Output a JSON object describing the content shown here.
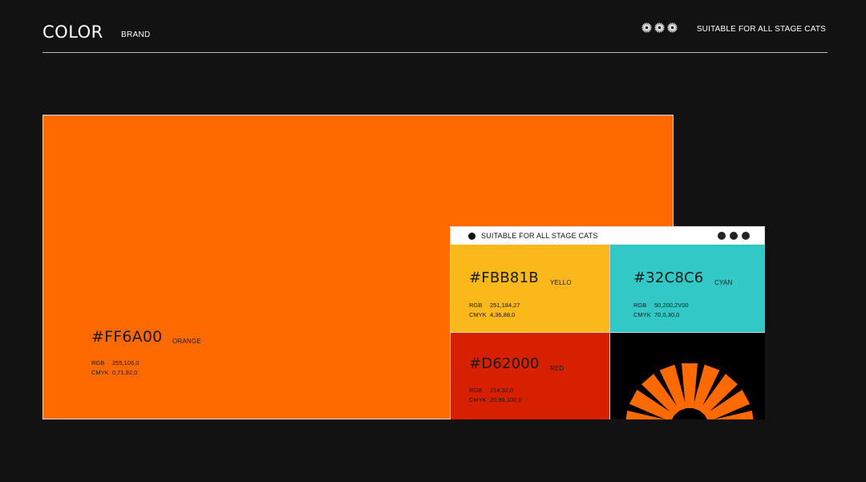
{
  "header": {
    "title": "COLOR",
    "subtitle": "BRAND",
    "tagline": "SUITABLE FOR ALL STAGE CATS",
    "icons": [
      "sunburst-icon",
      "sunburst-icon",
      "sunburst-icon"
    ]
  },
  "main_swatch": {
    "hex": "#FF6A00",
    "name": "ORANGE",
    "color": "#FF6A00",
    "rgb_label": "RGB",
    "rgb": "255,106,0",
    "cmyk_label": "CMYK",
    "cmyk": "0,71,92,0"
  },
  "card": {
    "title": "SUITABLE FOR ALL STAGE CATS",
    "swatches": [
      {
        "hex": "#FBB81B",
        "name": "YELLO",
        "color": "#FBB81B",
        "rgb_label": "RGB",
        "rgb": "251,184,27",
        "cmyk_label": "CMYK",
        "cmyk": "4,36,88,0"
      },
      {
        "hex": "#32C8C6",
        "name": "CYAN",
        "color": "#32C8C6",
        "rgb_label": "RGB",
        "rgb": "50,200,2V00",
        "cmyk_label": "CMYK",
        "cmyk": "70,0,30,0"
      },
      {
        "hex": "#D62000",
        "name": "RED",
        "color": "#D62000",
        "rgb_label": "RGB",
        "rgb": "214,32,0",
        "cmyk_label": "CMYK",
        "cmyk": "20,96,100,0"
      }
    ],
    "logo": {
      "icon": "sunburst-logo-icon",
      "color": "#FF6A00",
      "background": "#000000"
    }
  }
}
